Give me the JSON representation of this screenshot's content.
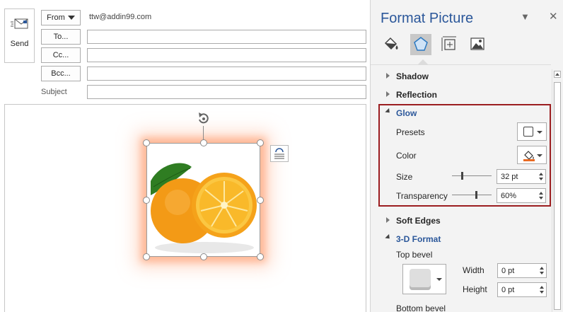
{
  "compose": {
    "send_label": "Send",
    "from_label": "From",
    "from_address": "ttw@addin99.com",
    "to_label": "To...",
    "cc_label": "Cc...",
    "bcc_label": "Bcc...",
    "subject_label": "Subject",
    "to_value": "",
    "cc_value": "",
    "bcc_value": "",
    "subject_value": ""
  },
  "pane": {
    "title": "Format Picture",
    "tabs": [
      {
        "icon": "fill-line-icon",
        "active": false
      },
      {
        "icon": "effects-icon",
        "active": true
      },
      {
        "icon": "size-properties-icon",
        "active": false
      },
      {
        "icon": "picture-icon",
        "active": false
      }
    ],
    "sections": {
      "shadow": "Shadow",
      "reflection": "Reflection",
      "glow": "Glow",
      "soft_edges": "Soft Edges",
      "format_3d": "3-D Format"
    },
    "glow": {
      "presets_label": "Presets",
      "color_label": "Color",
      "color_value": "#e96b23",
      "size_label": "Size",
      "size_value": "32 pt",
      "size_fraction": 0.25,
      "transparency_label": "Transparency",
      "transparency_value": "60%",
      "transparency_fraction": 0.6
    },
    "format3d": {
      "top_bevel_label": "Top bevel",
      "width_label": "Width",
      "width_value": "0 pt",
      "height_label": "Height",
      "height_value": "0 pt",
      "bottom_bevel_label": "Bottom bevel"
    }
  },
  "colors": {
    "accent": "#2b579a",
    "highlight_border": "#9b1d20",
    "glow": "#ff9a6e"
  }
}
